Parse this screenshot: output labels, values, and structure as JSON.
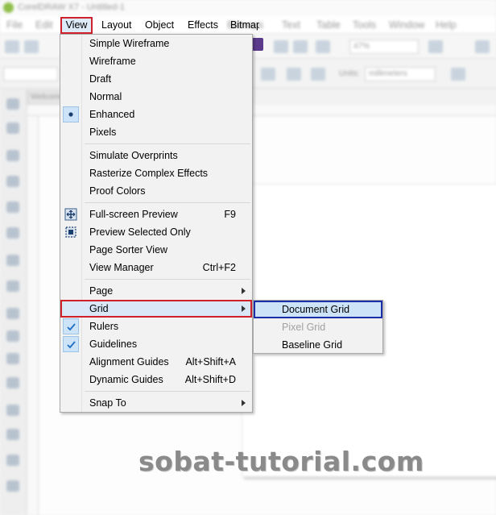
{
  "window": {
    "title": "CorelDRAW X7 - Untitled-1"
  },
  "menubar": {
    "items": [
      "File",
      "Edit",
      "View",
      "Layout",
      "Object",
      "Effects",
      "Bitmaps",
      "Text",
      "Table",
      "Tools",
      "Window",
      "Help"
    ],
    "active": "View"
  },
  "toolbar": {
    "zoom_value": "47%",
    "units_label": "Units:",
    "units_value": "millimeters",
    "brand_color": "#5b3a8c"
  },
  "document_tab": "Welcome",
  "view_menu": {
    "groups": [
      [
        {
          "label": "Simple Wireframe",
          "shortcut": "",
          "checked": false
        },
        {
          "label": "Wireframe",
          "shortcut": "",
          "checked": false
        },
        {
          "label": "Draft",
          "shortcut": "",
          "checked": false
        },
        {
          "label": "Normal",
          "shortcut": "",
          "checked": false
        },
        {
          "label": "Enhanced",
          "shortcut": "",
          "checked": "dot"
        },
        {
          "label": "Pixels",
          "shortcut": "",
          "checked": false
        }
      ],
      [
        {
          "label": "Simulate Overprints",
          "shortcut": ""
        },
        {
          "label": "Rasterize Complex Effects",
          "shortcut": ""
        },
        {
          "label": "Proof Colors",
          "shortcut": ""
        }
      ],
      [
        {
          "label": "Full-screen Preview",
          "shortcut": "F9",
          "icon": "fullscreen-preview-icon"
        },
        {
          "label": "Preview Selected Only",
          "shortcut": "",
          "icon": "preview-selected-icon"
        },
        {
          "label": "Page Sorter View",
          "shortcut": ""
        },
        {
          "label": "View Manager",
          "shortcut": "Ctrl+F2"
        }
      ],
      [
        {
          "label": "Page",
          "submenu": true
        },
        {
          "label": "Grid",
          "submenu": true,
          "highlighted": true
        },
        {
          "label": "Rulers",
          "checked": "check"
        },
        {
          "label": "Guidelines",
          "checked": "check"
        },
        {
          "label": "Alignment Guides",
          "shortcut": "Alt+Shift+A"
        },
        {
          "label": "Dynamic Guides",
          "shortcut": "Alt+Shift+D"
        }
      ],
      [
        {
          "label": "Snap To",
          "submenu": true
        }
      ]
    ]
  },
  "grid_submenu": {
    "items": [
      {
        "label": "Document Grid",
        "enabled": true,
        "active": true
      },
      {
        "label": "Pixel Grid",
        "enabled": false
      },
      {
        "label": "Baseline Grid",
        "enabled": true
      }
    ]
  },
  "colors": {
    "highlight_red": "#d0202a",
    "highlight_blue": "#1d2fa8",
    "menu_hover": "#d9e7f6",
    "check_bg": "#cde3f7",
    "check_mark": "#1f6fc2"
  },
  "watermark": "sobat-tutorial.com"
}
